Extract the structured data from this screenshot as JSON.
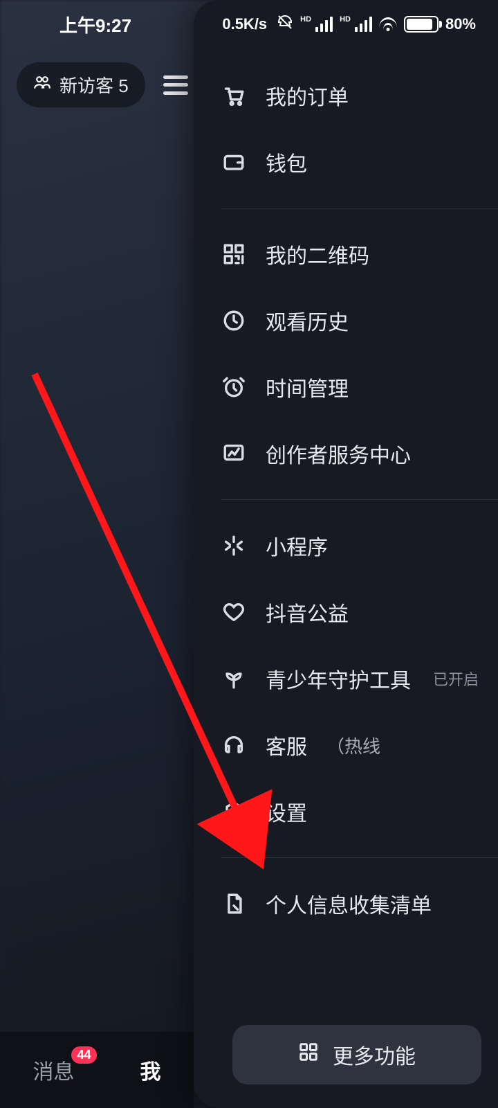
{
  "status": {
    "time": "上午9:27",
    "speed": "0.5K/s",
    "battery_pct": "80%"
  },
  "visitor_pill": {
    "label": "新访客 5"
  },
  "tabs": {
    "messages": {
      "label": "消息",
      "badge": "44"
    },
    "me": {
      "label": "我"
    }
  },
  "menu": {
    "orders": {
      "label": "我的订单"
    },
    "wallet": {
      "label": "钱包"
    },
    "qrcode": {
      "label": "我的二维码"
    },
    "history": {
      "label": "观看历史"
    },
    "time_mgmt": {
      "label": "时间管理"
    },
    "creator": {
      "label": "创作者服务中心"
    },
    "miniapp": {
      "label": "小程序"
    },
    "charity": {
      "label": "抖音公益"
    },
    "youth": {
      "label": "青少年守护工具",
      "tag": "已开启"
    },
    "support": {
      "label": "客服",
      "sub": "（热线"
    },
    "settings": {
      "label": "设置"
    },
    "privacy_list": {
      "label": "个人信息收集清单"
    }
  },
  "more_btn": {
    "label": "更多功能"
  }
}
